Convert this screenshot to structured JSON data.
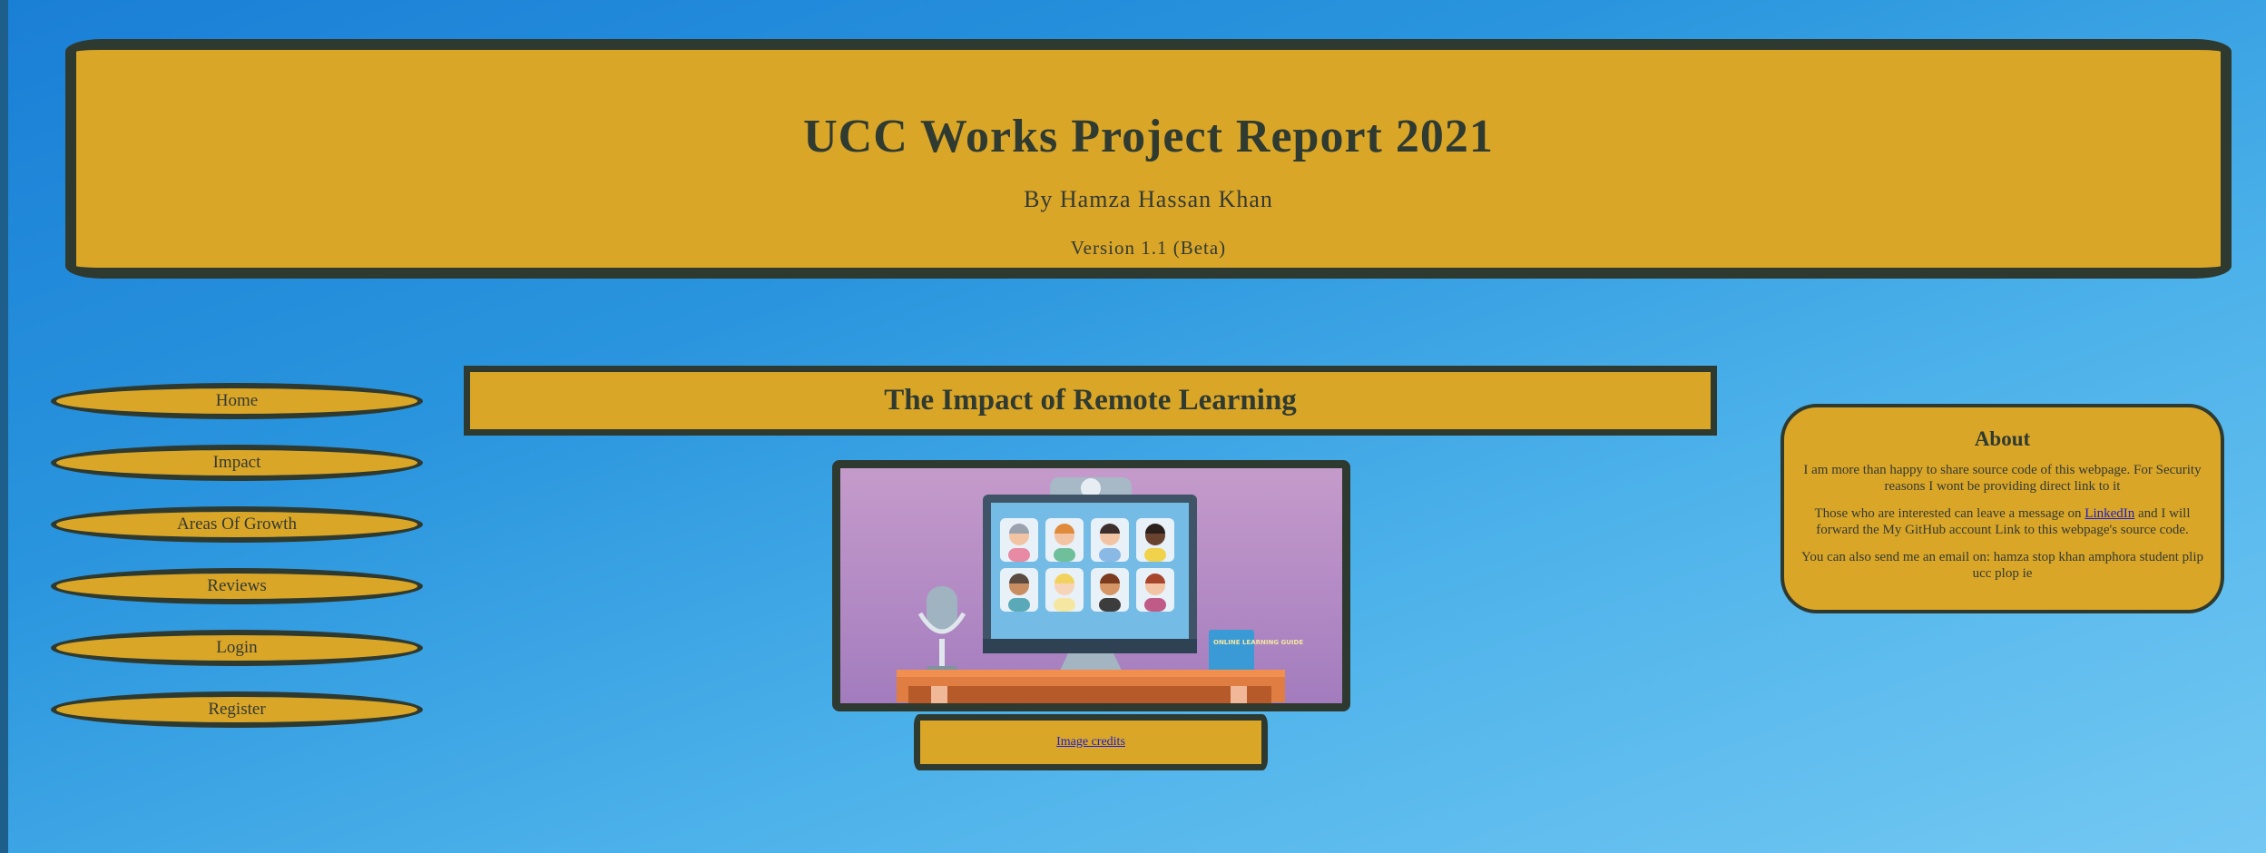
{
  "header": {
    "title": "UCC Works Project Report 2021",
    "byline": "By Hamza Hassan Khan",
    "version": "Version 1.1 (Beta)"
  },
  "nav": {
    "items": [
      {
        "label": "Home"
      },
      {
        "label": "Impact"
      },
      {
        "label": "Areas Of Growth"
      },
      {
        "label": "Reviews"
      },
      {
        "label": "Login"
      },
      {
        "label": "Register"
      }
    ]
  },
  "main": {
    "title": "The Impact of Remote Learning",
    "image_book_text": "ONLINE LEARNING GUIDE",
    "credits_link": "Image credits"
  },
  "about": {
    "title": "About",
    "p1": "I am more than happy to share source code of this webpage. For Security reasons I wont be providing direct link to it",
    "p2_before": "Those who are interested can leave a message on ",
    "p2_link": "LinkedIn",
    "p2_after": " and I will forward the My GitHub account Link to this webpage's source code.",
    "p3": "You can also send me an email on: hamza stop khan amphora student plip ucc plop ie"
  },
  "colors": {
    "panel": "#daa628",
    "border": "#2e3a30",
    "link": "#2020cc",
    "background": "#2a95de"
  }
}
